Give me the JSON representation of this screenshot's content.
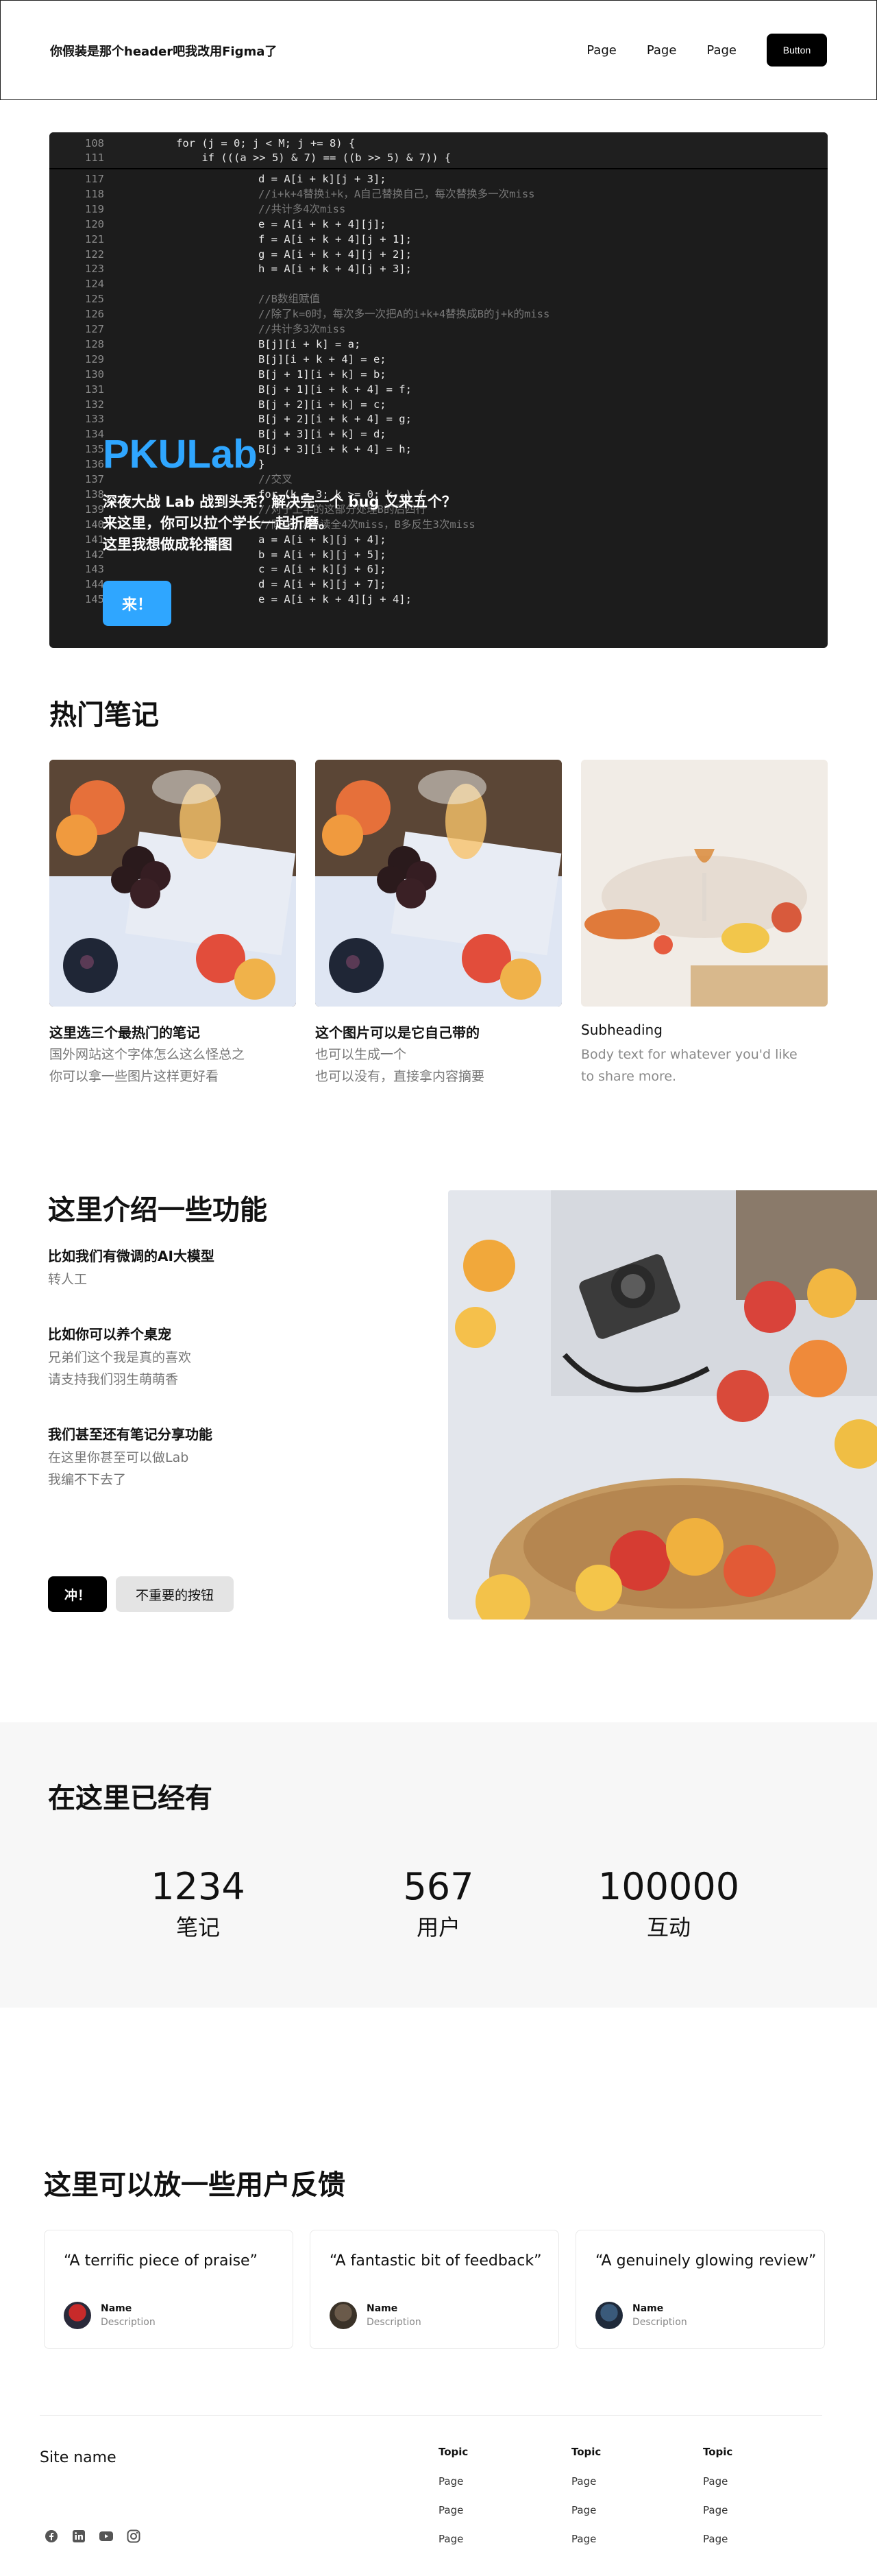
{
  "header": {
    "brand": "你假装是那个header吧我改用Figma了",
    "nav": [
      "Page",
      "Page",
      "Page"
    ],
    "button": "Button"
  },
  "hero": {
    "title": "PKULab",
    "subtitle_lines": [
      "深夜大战 Lab 战到头秃？解决完一个 bug 又来五个？",
      "来这里，你可以拉个学长一起折磨。",
      "这里我想做成轮播图"
    ],
    "cta": "来！",
    "code_lines": [
      {
        "n": "108",
        "t": "for (j = 0; j < M; j += 8) {"
      },
      {
        "n": "111",
        "t": "    if (((a >> 5) & 7) == ((b >> 5) & 7)) {"
      },
      {
        "n": "117",
        "t": "d = A[i + k][j + 3];"
      },
      {
        "n": "118",
        "t": "//i+k+4替换i+k，A自己替换自己，每次替换多一次miss"
      },
      {
        "n": "119",
        "t": "//共计多4次miss"
      },
      {
        "n": "120",
        "t": "e = A[i + k + 4][j];"
      },
      {
        "n": "121",
        "t": "f = A[i + k + 4][j + 1];"
      },
      {
        "n": "122",
        "t": "g = A[i + k + 4][j + 2];"
      },
      {
        "n": "123",
        "t": "h = A[i + k + 4][j + 3];"
      },
      {
        "n": "124",
        "t": ""
      },
      {
        "n": "125",
        "t": "//B数组赋值"
      },
      {
        "n": "126",
        "t": "//除了k=0时，每次多一次把A的i+k+4替换成B的j+k的miss"
      },
      {
        "n": "127",
        "t": "//共计多3次miss"
      },
      {
        "n": "128",
        "t": "B[j][i + k] = a;"
      },
      {
        "n": "129",
        "t": "B[j][i + k + 4] = e;"
      },
      {
        "n": "130",
        "t": "B[j + 1][i + k] = b;"
      },
      {
        "n": "131",
        "t": "B[j + 1][i + k + 4] = f;"
      },
      {
        "n": "132",
        "t": "B[j + 2][i + k] = c;"
      },
      {
        "n": "133",
        "t": "B[j + 2][i + k + 4] = g;"
      },
      {
        "n": "134",
        "t": "B[j + 3][i + k] = d;"
      },
      {
        "n": "135",
        "t": "B[j + 3][i + k + 4] = h;"
      },
      {
        "n": "136",
        "t": "}"
      },
      {
        "n": "137",
        "t": "//交叉"
      },
      {
        "n": "138",
        "t": "for (k = 3; k >= 0; k--) {"
      },
      {
        "n": "139",
        "t": "//对于上半的这部分处理B的后四行"
      },
      {
        "n": "140",
        "t": "//同样，A多读全4次miss，B多反生3次miss"
      },
      {
        "n": "141",
        "t": "a = A[i + k][j + 4];"
      },
      {
        "n": "142",
        "t": "b = A[i + k][j + 5];"
      },
      {
        "n": "143",
        "t": "c = A[i + k][j + 6];"
      },
      {
        "n": "144",
        "t": "d = A[i + k][j + 7];"
      },
      {
        "n": "145",
        "t": "e = A[i + k + 4][j + 4];"
      }
    ]
  },
  "popular": {
    "heading": "热门笔记",
    "cards": [
      {
        "title": "这里选三个最热门的笔记",
        "body": [
          "国外网站这个字体怎么这么怪总之",
          "你可以拿一些图片这样更好看"
        ]
      },
      {
        "title": "这个图片可以是它自己带的",
        "body": [
          "也可以生成一个",
          "也可以没有，直接拿内容摘要"
        ]
      },
      {
        "title": "Subheading",
        "body": [
          "Body text for whatever you'd like",
          "to share more."
        ]
      }
    ]
  },
  "features": {
    "heading": "这里介绍一些功能",
    "items": [
      {
        "title": "比如我们有微调的AI大模型",
        "body": [
          "转人工"
        ]
      },
      {
        "title": "比如你可以养个桌宠",
        "body": [
          "兄弟们这个我是真的喜欢",
          "请支持我们羽生萌萌香"
        ]
      },
      {
        "title": "我们甚至还有笔记分享功能",
        "body": [
          "在这里你甚至可以做Lab",
          "我编不下去了"
        ]
      }
    ],
    "primary_button": "冲！",
    "secondary_button": "不重要的按钮"
  },
  "stats": {
    "heading": "在这里已经有",
    "items": [
      {
        "value": "1234",
        "label": "笔记"
      },
      {
        "value": "567",
        "label": "用户"
      },
      {
        "value": "100000",
        "label": "互动"
      }
    ]
  },
  "feedback": {
    "heading": "这里可以放一些用户反馈",
    "items": [
      {
        "quote": "“A terrific piece of praise”",
        "name": "Name",
        "desc": "Description"
      },
      {
        "quote": "“A fantastic bit of feedback”",
        "name": "Name",
        "desc": "Description"
      },
      {
        "quote": "“A genuinely glowing review”",
        "name": "Name",
        "desc": "Description"
      }
    ]
  },
  "footer": {
    "site_name": "Site name",
    "social_icons": [
      "facebook-icon",
      "linkedin-icon",
      "youtube-icon",
      "instagram-icon"
    ],
    "columns": [
      {
        "topic": "Topic",
        "pages": [
          "Page",
          "Page",
          "Page"
        ]
      },
      {
        "topic": "Topic",
        "pages": [
          "Page",
          "Page",
          "Page"
        ]
      },
      {
        "topic": "Topic",
        "pages": [
          "Page",
          "Page",
          "Page"
        ]
      }
    ]
  },
  "colors": {
    "accent": "#2fa6ff",
    "dark": "#000000",
    "muted": "#777777",
    "stats_bg": "#f7f7f7"
  }
}
